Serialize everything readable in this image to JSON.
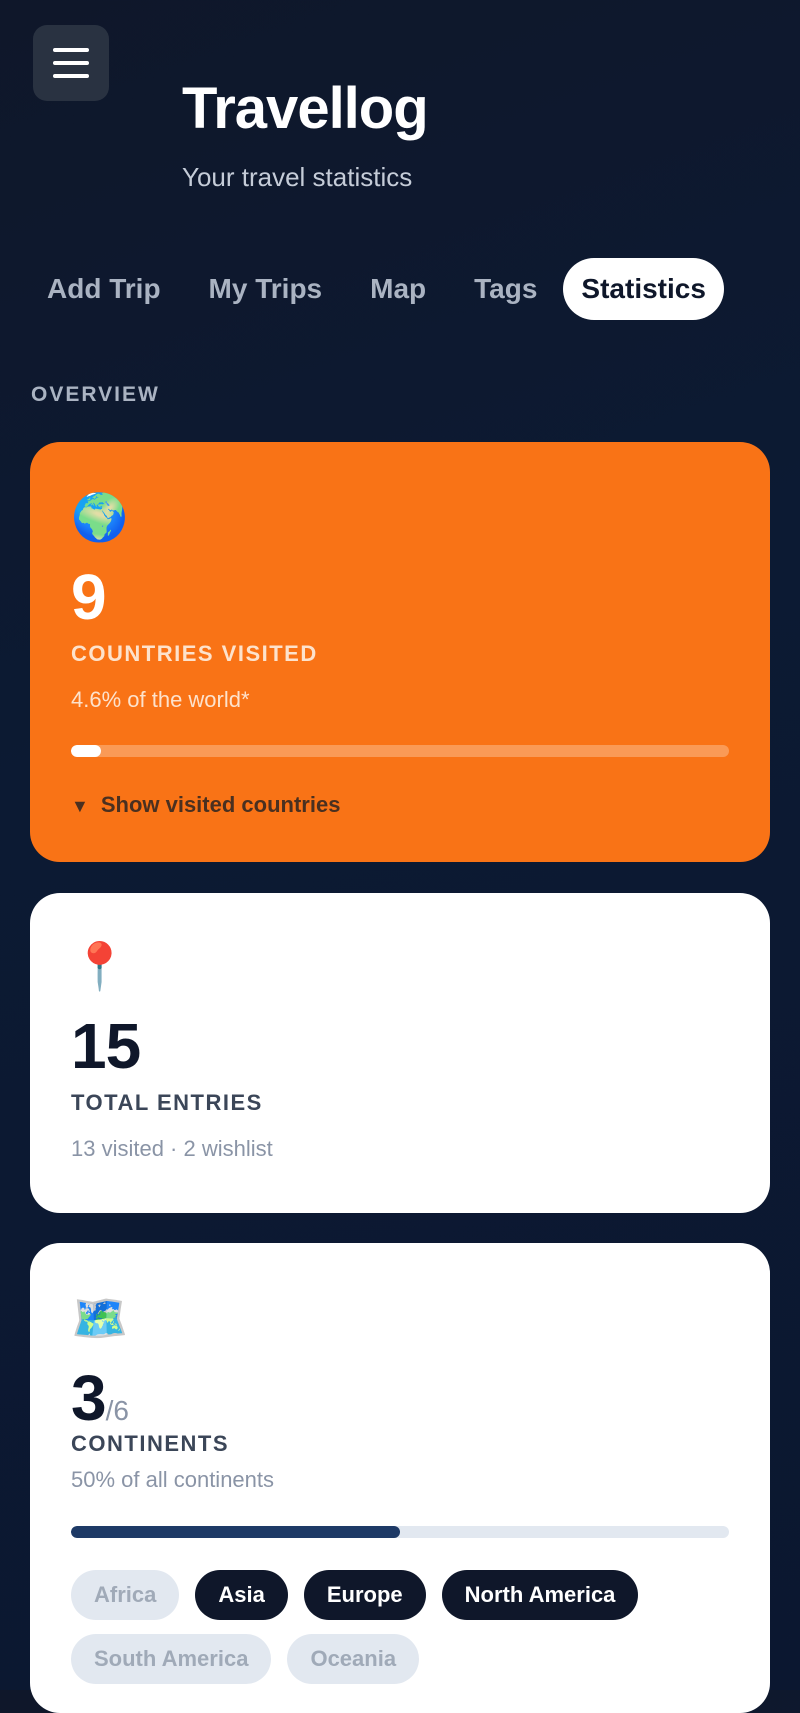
{
  "header": {
    "menu_icon": "hamburger-menu-icon",
    "title": "Travellog",
    "subtitle": "Your travel statistics"
  },
  "tabs": [
    {
      "label": "Add Trip",
      "active": false
    },
    {
      "label": "My Trips",
      "active": false
    },
    {
      "label": "Map",
      "active": false
    },
    {
      "label": "Tags",
      "active": false
    },
    {
      "label": "Statistics",
      "active": true
    }
  ],
  "overview": {
    "section_label": "OVERVIEW",
    "countries": {
      "icon": "🌍",
      "value": "9",
      "label": "COUNTRIES VISITED",
      "sub": "4.6% of the world*",
      "progress_percent": 4.6,
      "toggle_arrow": "▼",
      "toggle_label": "Show visited countries",
      "accent_color": "#f97316"
    },
    "entries": {
      "icon": "📍",
      "value": "15",
      "label": "TOTAL ENTRIES",
      "sub": "13 visited · 2 wishlist"
    },
    "continents": {
      "icon": "🗺️",
      "value": "3",
      "of": "/6",
      "label": "CONTINENTS",
      "sub": "50% of all continents",
      "progress_percent": 50,
      "bar_color": "#1e3a66",
      "items": [
        {
          "label": "Africa",
          "visited": false
        },
        {
          "label": "Asia",
          "visited": true
        },
        {
          "label": "Europe",
          "visited": true
        },
        {
          "label": "North America",
          "visited": true
        },
        {
          "label": "South America",
          "visited": false
        },
        {
          "label": "Oceania",
          "visited": false
        }
      ]
    }
  }
}
